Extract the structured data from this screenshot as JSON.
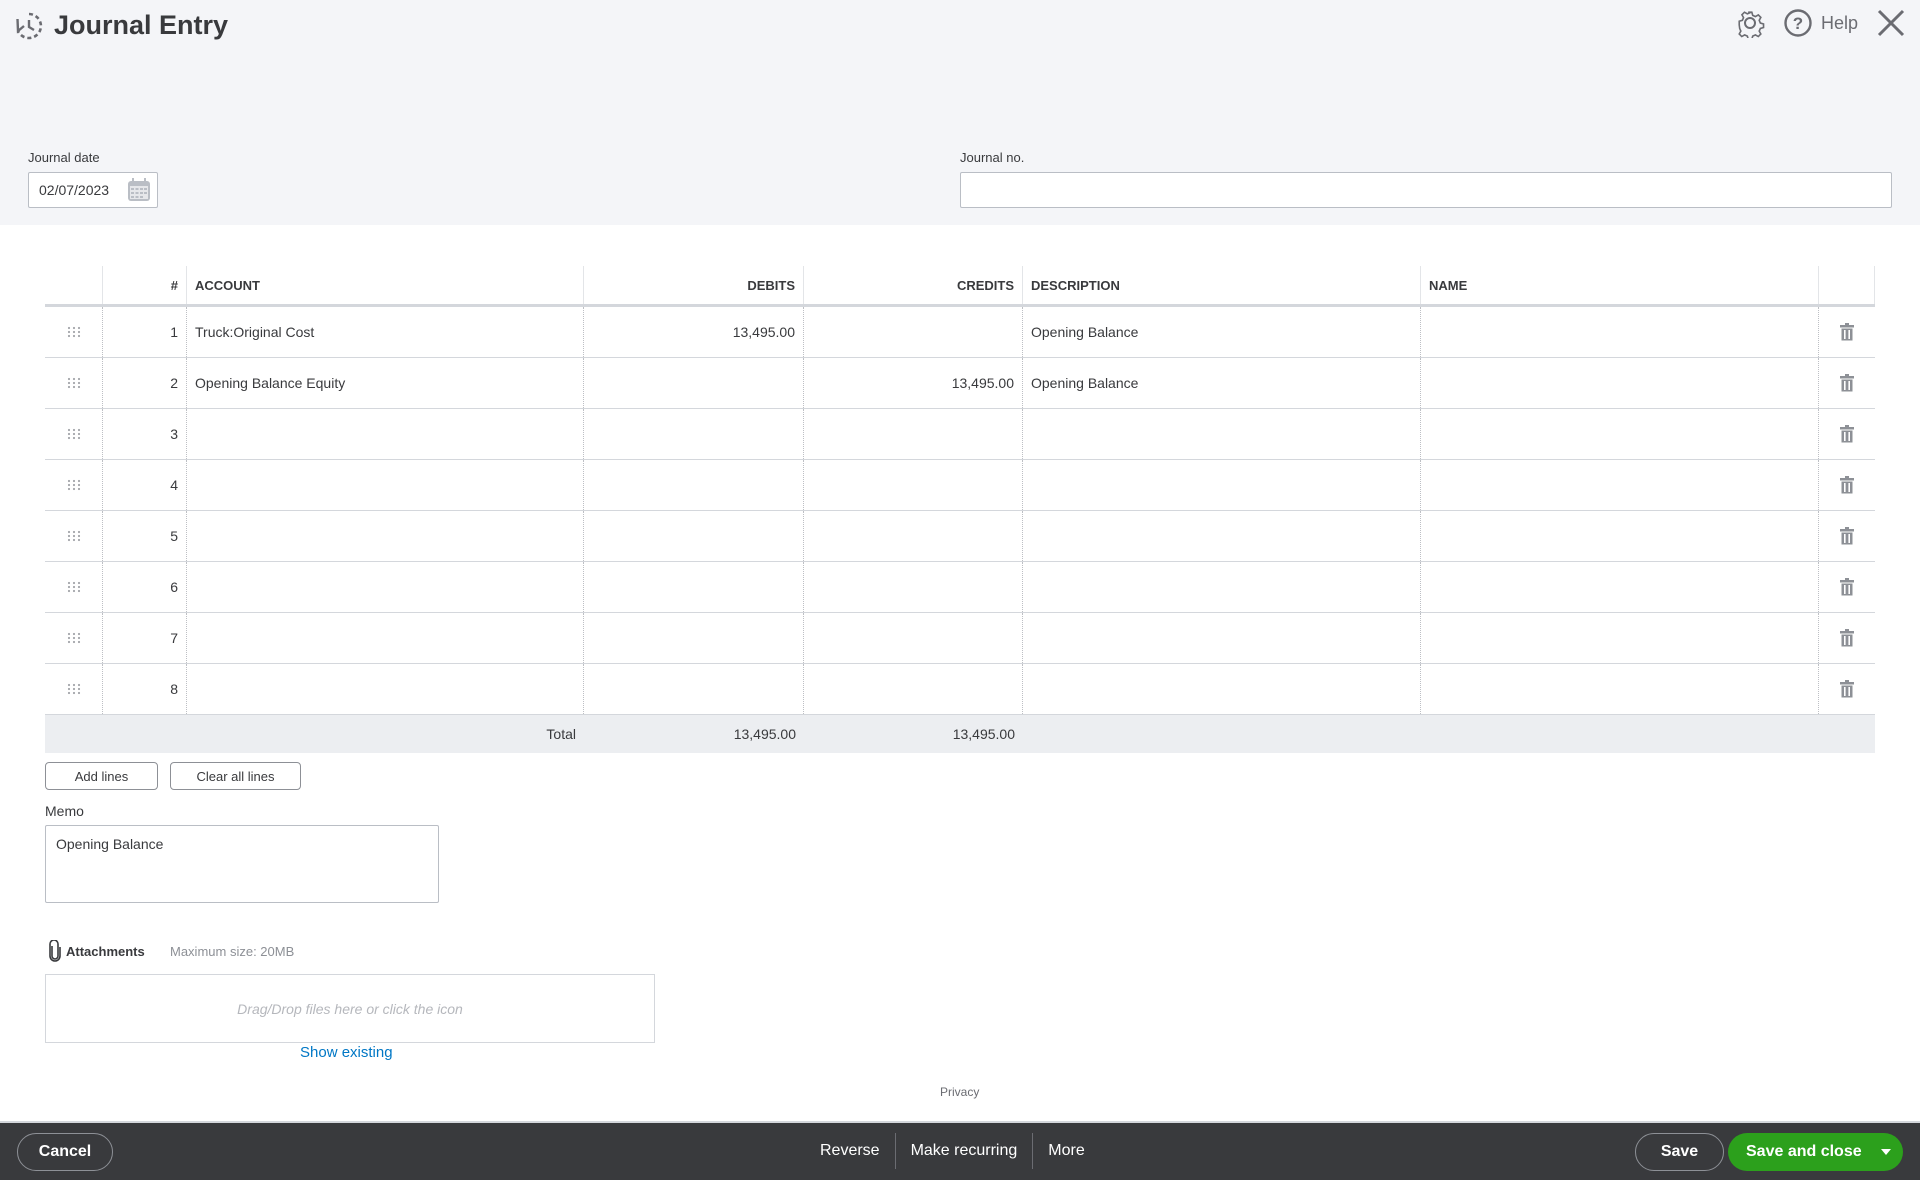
{
  "header": {
    "title": "Journal Entry",
    "help_label": "Help",
    "icons": {
      "recent": "recent-transactions-icon",
      "settings": "gear-icon",
      "help": "help-circle-icon",
      "close": "close-icon"
    }
  },
  "form": {
    "journal_date_label": "Journal date",
    "journal_date_value": "02/07/2023",
    "journal_no_label": "Journal no.",
    "journal_no_value": ""
  },
  "table": {
    "columns": {
      "num": "#",
      "account": "ACCOUNT",
      "debits": "DEBITS",
      "credits": "CREDITS",
      "description": "DESCRIPTION",
      "name": "NAME"
    },
    "rows": [
      {
        "num": "1",
        "account": "Truck:Original Cost",
        "debits": "13,495.00",
        "credits": "",
        "description": "Opening Balance",
        "name": ""
      },
      {
        "num": "2",
        "account": "Opening Balance Equity",
        "debits": "",
        "credits": "13,495.00",
        "description": "Opening Balance",
        "name": ""
      },
      {
        "num": "3",
        "account": "",
        "debits": "",
        "credits": "",
        "description": "",
        "name": ""
      },
      {
        "num": "4",
        "account": "",
        "debits": "",
        "credits": "",
        "description": "",
        "name": ""
      },
      {
        "num": "5",
        "account": "",
        "debits": "",
        "credits": "",
        "description": "",
        "name": ""
      },
      {
        "num": "6",
        "account": "",
        "debits": "",
        "credits": "",
        "description": "",
        "name": ""
      },
      {
        "num": "7",
        "account": "",
        "debits": "",
        "credits": "",
        "description": "",
        "name": ""
      },
      {
        "num": "8",
        "account": "",
        "debits": "",
        "credits": "",
        "description": "",
        "name": ""
      }
    ],
    "total_label": "Total",
    "total_debits": "13,495.00",
    "total_credits": "13,495.00"
  },
  "actions": {
    "add_lines": "Add lines",
    "clear_all_lines": "Clear all lines"
  },
  "memo": {
    "label": "Memo",
    "value": "Opening Balance"
  },
  "attachments": {
    "label": "Attachments",
    "max_size": "Maximum size: 20MB",
    "drop_text": "Drag/Drop files here or click the icon",
    "show_existing": "Show existing"
  },
  "privacy_label": "Privacy",
  "footer": {
    "cancel": "Cancel",
    "reverse": "Reverse",
    "make_recurring": "Make recurring",
    "more": "More",
    "save": "Save",
    "save_and_close": "Save and close"
  },
  "colors": {
    "primary_green": "#2ca01c",
    "footer_bg": "#393a3d",
    "link_blue": "#0077c5"
  }
}
